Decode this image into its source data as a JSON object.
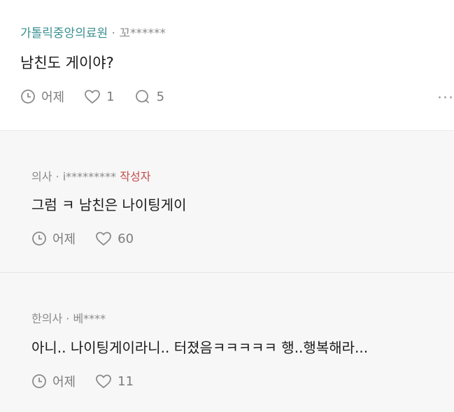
{
  "post": {
    "company": "가톨릭중앙의료원",
    "separator": "·",
    "author": "꼬******",
    "text": "남친도 게이야?",
    "time": "어제",
    "likes": "1",
    "comments": "5",
    "more": "···"
  },
  "comments": [
    {
      "company": "의사",
      "separator": "·",
      "author": "i*********",
      "badge": "작성자",
      "text": "그럼 ㅋ 남친은 나이팅게이",
      "time": "어제",
      "likes": "60"
    },
    {
      "company": "한의사",
      "separator": "·",
      "author": "베****",
      "text": "아니.. 나이팅게이라니.. 터졌음ㅋㅋㅋㅋㅋ 행..행복해라...",
      "time": "어제",
      "likes": "11"
    }
  ],
  "colors": {
    "company": "#3a8f8f",
    "writer_badge": "#c84a4a",
    "muted": "#7c7c7c"
  }
}
